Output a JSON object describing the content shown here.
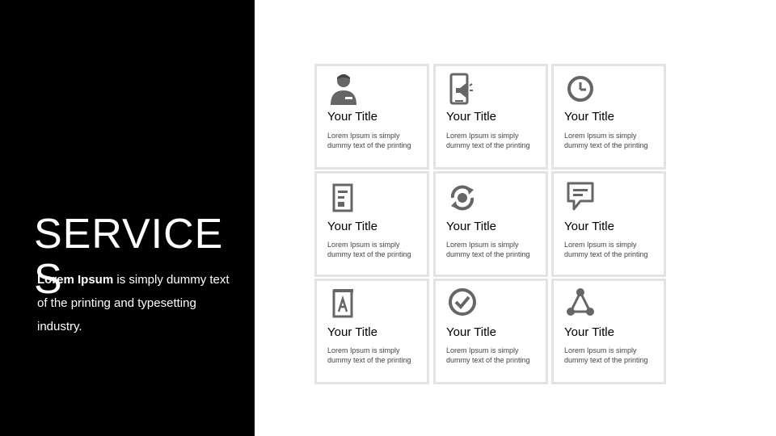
{
  "slide": {
    "title": "SERVICES",
    "description": {
      "bold": "Lorem Ipsum",
      "rest": " is simply dummy text of the printing and typesetting industry."
    }
  },
  "cards": [
    {
      "icon": "person-icon",
      "title": "Your Title",
      "text": "Lorem Ipsum is simply dummy text of the printing"
    },
    {
      "icon": "mobile-megaphone-icon",
      "title": "Your Title",
      "text": "Lorem Ipsum is simply dummy text of the printing"
    },
    {
      "icon": "clock-icon",
      "title": "Your Title",
      "text": "Lorem Ipsum is simply dummy text of the printing"
    },
    {
      "icon": "document-icon",
      "title": "Your Title",
      "text": "Lorem Ipsum is simply dummy text of the printing"
    },
    {
      "icon": "refresh-icon",
      "title": "Your Title",
      "text": "Lorem Ipsum is simply dummy text of the printing"
    },
    {
      "icon": "chat-icon",
      "title": "Your Title",
      "text": "Lorem Ipsum is simply dummy text of the printing"
    },
    {
      "icon": "book-icon",
      "title": "Your Title",
      "text": "Lorem Ipsum is simply dummy text of the printing"
    },
    {
      "icon": "check-circle-icon",
      "title": "Your Title",
      "text": "Lorem Ipsum is simply dummy text of the printing"
    },
    {
      "icon": "share-nodes-icon",
      "title": "Your Title",
      "text": "Lorem Ipsum is simply dummy text of the printing"
    }
  ],
  "colors": {
    "panel": "#000000",
    "card_border": "#e3e3e3",
    "icon": "#666666"
  }
}
